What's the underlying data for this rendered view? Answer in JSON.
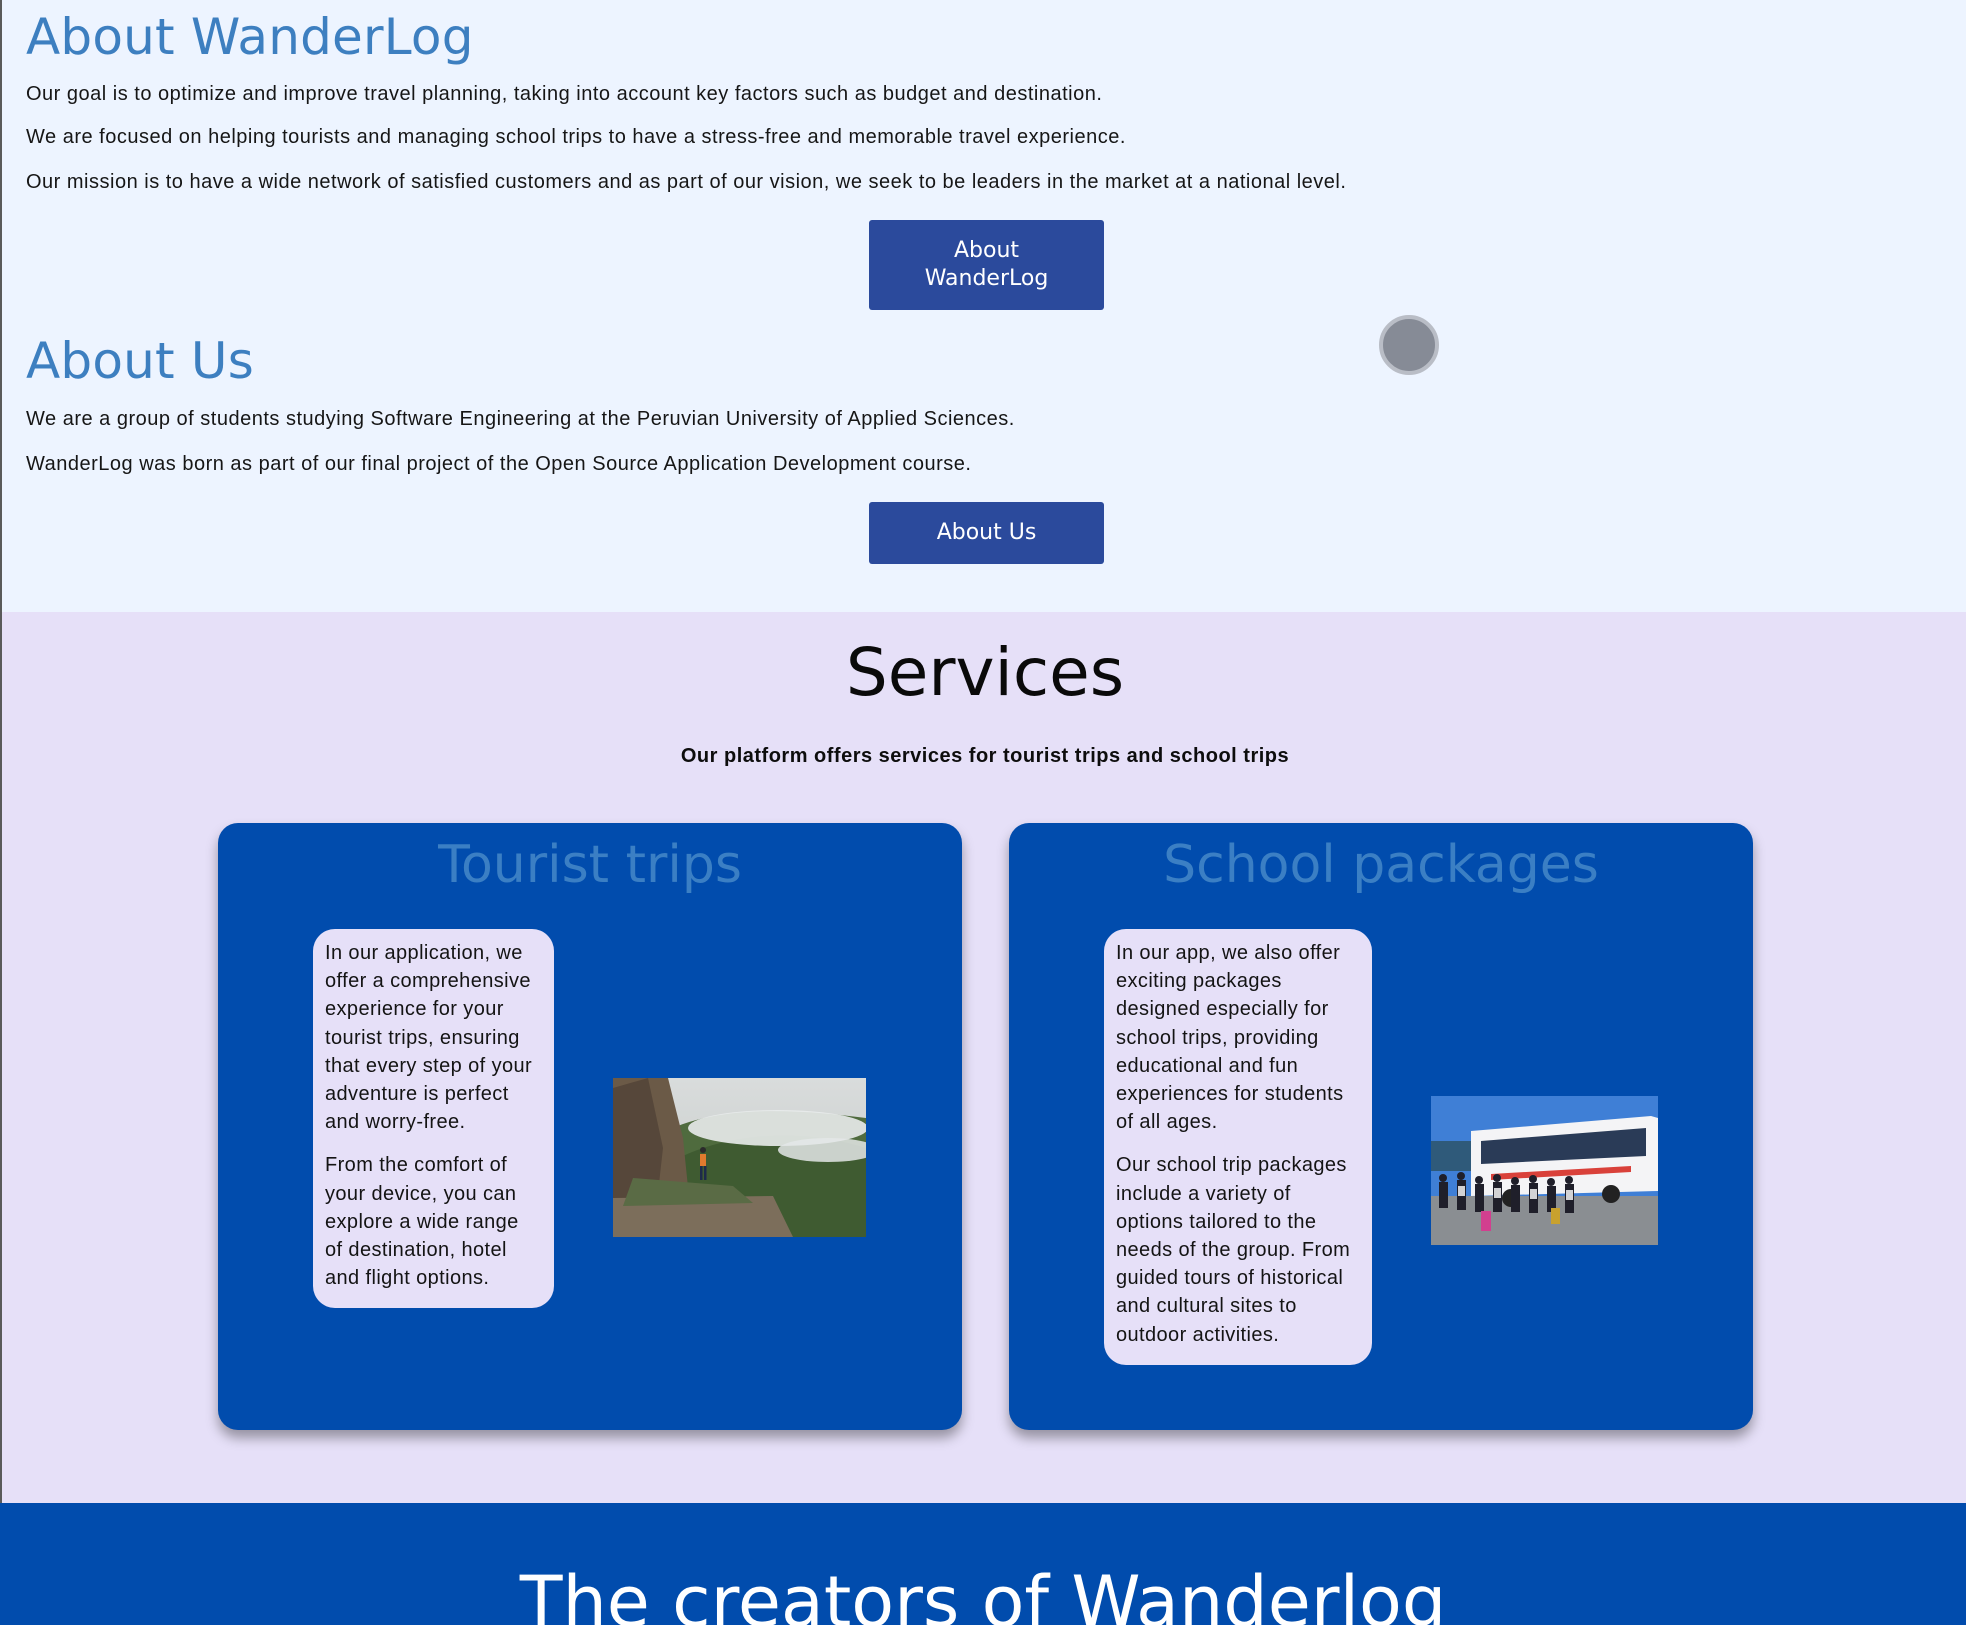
{
  "about_wanderlog": {
    "heading": "About WanderLog",
    "paragraphs": [
      "Our goal is to optimize and improve travel planning, taking into account key factors such as budget and destination.",
      "We are focused on helping tourists and managing school trips to have a stress-free and memorable travel experience.",
      "Our mission is to have a wide network of satisfied customers and as part of our vision, we seek to be leaders in the market at a national level."
    ],
    "button_label": "About WanderLog"
  },
  "about_us": {
    "heading": "About Us",
    "paragraphs": [
      "We are a group of students studying Software Engineering at the Peruvian University of Applied Sciences.",
      "WanderLog was born as part of our final project of the Open Source Application Development course."
    ],
    "button_label": "About Us"
  },
  "services": {
    "title": "Services",
    "subtitle": "Our platform offers services for tourist trips and school trips",
    "cards": [
      {
        "title": "Tourist trips",
        "paragraphs": [
          "In our application, we offer a comprehensive experience for your tourist trips, ensuring that every step of your adventure is perfect and worry-free.",
          "From the comfort of your device, you can explore a wide range of destination, hotel and flight options."
        ],
        "image": "photo-hiker-on-mountain-trail"
      },
      {
        "title": "School packages",
        "paragraphs": [
          "In our app, we also offer exciting packages designed especially for school trips, providing educational and fun experiences for students of all ages.",
          "Our school trip packages include a variety of options tailored to the needs of the group. From guided tours of historical and cultural sites to outdoor activities."
        ],
        "image": "photo-students-by-tour-bus"
      }
    ]
  },
  "creators": {
    "title": "The creators of Wanderlog"
  },
  "colors": {
    "page_background": "#edf4ff",
    "services_background": "#e6e0f8",
    "primary_blue": "#014cad",
    "button_blue": "#2b4a9c",
    "heading_blue": "#3d7fc0"
  }
}
